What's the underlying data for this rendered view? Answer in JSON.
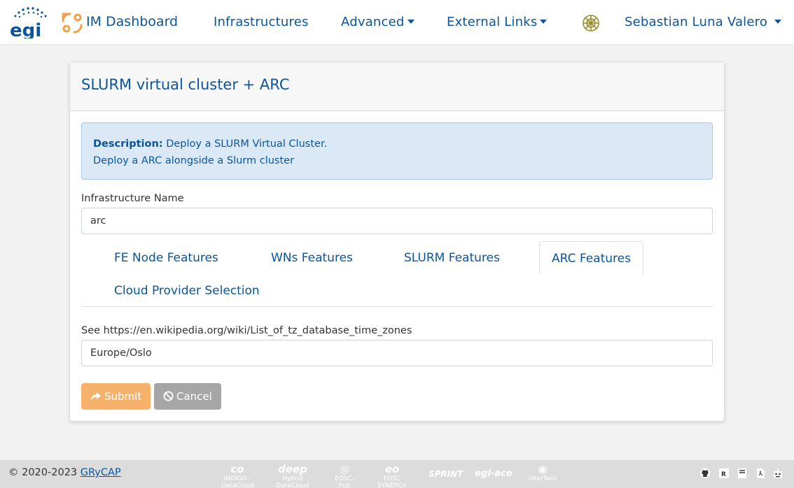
{
  "navbar": {
    "brand": "IM Dashboard",
    "links": [
      {
        "label": "Infrastructures",
        "dropdown": false
      },
      {
        "label": "Advanced",
        "dropdown": true
      },
      {
        "label": "External Links",
        "dropdown": true
      }
    ],
    "user": "Sebastian Luna Valero",
    "logo_icon": "egi-logo-icon",
    "brand_icon": "im-arrows-icon",
    "grid_icon": "egi-grid-icon"
  },
  "card": {
    "title": "SLURM virtual cluster + ARC",
    "description_label": "Description:",
    "description_line1": "Deploy a SLURM Virtual Cluster.",
    "description_line2": "Deploy a ARC alongside a Slurm cluster",
    "infra_name_label": "Infrastructure Name",
    "infra_name_value": "arc",
    "tabs": [
      {
        "label": "FE Node Features",
        "active": false
      },
      {
        "label": "WNs Features",
        "active": false
      },
      {
        "label": "SLURM Features",
        "active": false
      },
      {
        "label": "ARC Features",
        "active": true
      },
      {
        "label": "Cloud Provider Selection",
        "active": false
      }
    ],
    "tz_label": "See https://en.wikipedia.org/wiki/List_of_tz_database_time_zones",
    "tz_value": "Europe/Oslo",
    "submit_label": "Submit",
    "cancel_label": "Cancel"
  },
  "footer": {
    "copyright": "© 2020-2023",
    "org_link": "GRyCAP",
    "partners": [
      {
        "mark": "co",
        "sub": "INDIGO - DataCloud"
      },
      {
        "mark": "deep",
        "sub": "Hybrid DataCloud"
      },
      {
        "mark": "◎",
        "sub": "EOSC-hub"
      },
      {
        "mark": "eo",
        "sub": "EOSC SYNERGY"
      },
      {
        "mark": "SPRINT",
        "sub": ""
      },
      {
        "mark": "egi-ace",
        "sub": ""
      },
      {
        "mark": "◉",
        "sub": "interTwin"
      }
    ],
    "icons": [
      "github-icon",
      "r-project-icon",
      "book-icon",
      "pdf-file-icon",
      "robot-icon"
    ]
  },
  "colors": {
    "primary": "#0a559c",
    "submit": "#f6b26b",
    "cancel": "#a6a6a6",
    "alert_bg": "#dbe9f7"
  }
}
